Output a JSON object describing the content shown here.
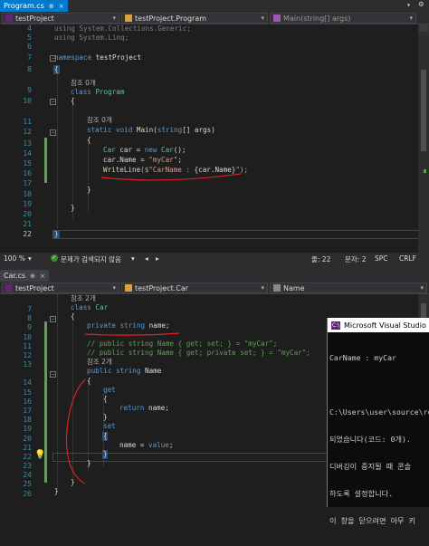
{
  "top": {
    "tab": {
      "label": "Program.cs",
      "pin": "⊕",
      "close": "×"
    },
    "nav": {
      "project": "testProject",
      "class": "testProject.Program",
      "member": "Main(string[] args)"
    },
    "lines": [
      {
        "n": "4"
      },
      {
        "n": "5"
      },
      {
        "n": "6"
      },
      {
        "n": "7"
      },
      {
        "n": "8"
      },
      {
        "n": "9"
      },
      {
        "n": "10"
      },
      {
        "n": "11"
      },
      {
        "n": "12"
      },
      {
        "n": "13"
      },
      {
        "n": "14"
      },
      {
        "n": "15"
      },
      {
        "n": "16"
      },
      {
        "n": "17"
      },
      {
        "n": "18"
      },
      {
        "n": "19"
      },
      {
        "n": "20"
      },
      {
        "n": "21"
      },
      {
        "n": "22"
      }
    ],
    "code": {
      "l4a": "using",
      "l4b": " System.Collections.Generic;",
      "l5a": "using",
      "l5b": " System.Linq;",
      "l7a": "namespace",
      "l7b": " testProject",
      "l8": "{",
      "l9ref": "참조 0개",
      "l9a": "class",
      "l9b": "Program",
      "l10": "{",
      "l11ref": "참조 0개",
      "l11a": "static",
      "l11b": "void",
      "l11c": "Main",
      "l11d": "(",
      "l11e": "string",
      "l11f": "[] args)",
      "l12": "{",
      "l13a": "Car",
      "l13b": " car = ",
      "l13c": "new",
      "l13d": " Car",
      "l13e": "();",
      "l14a": "car.Name = ",
      "l14b": "\"myCar\"",
      "l14c": ";",
      "l15a": "WriteLine",
      "l15b": "($\"",
      "l15c": "CarName : ",
      "l15d": "{car.Name}",
      "l15e": "\");",
      "l17": "}",
      "l19": "}",
      "l20": "}"
    }
  },
  "status": {
    "zoom": "100 %",
    "issues": "문제가 검색되지 않음",
    "line": "줄: 22",
    "char": "문자: 2",
    "ws": "SPC",
    "eol": "CRLF"
  },
  "bottom": {
    "tab": {
      "label": "Car.cs",
      "pin": "⊕",
      "close": "×"
    },
    "nav": {
      "project": "testProject",
      "class": "testProject.Car",
      "member": "Name"
    },
    "lines": [
      {
        "n": "7"
      },
      {
        "n": "8"
      },
      {
        "n": "9"
      },
      {
        "n": "10"
      },
      {
        "n": "11"
      },
      {
        "n": "12"
      },
      {
        "n": "13"
      },
      {
        "n": "14"
      },
      {
        "n": "15"
      },
      {
        "n": "16"
      },
      {
        "n": "17"
      },
      {
        "n": "18"
      },
      {
        "n": "19"
      },
      {
        "n": "20"
      },
      {
        "n": "21"
      },
      {
        "n": "22"
      },
      {
        "n": "23"
      },
      {
        "n": "24"
      },
      {
        "n": "25"
      },
      {
        "n": "26"
      }
    ],
    "code": {
      "ref7": "참조 2개",
      "l8a": "class",
      "l8b": " Car",
      "l9": "{",
      "l10a": "private",
      "l10b": " string",
      "l10c": " name;",
      "l12": "// public string Name { get; set; } = \"myCar\";",
      "l13": "// public string Name { get; private set; } = \"myCar\";",
      "ref13": "참조 2개",
      "l14a": "public",
      "l14b": " string",
      "l14c": " Name",
      "l15": "{",
      "l16": "get",
      "l17": "{",
      "l18a": "return",
      "l18b": " name;",
      "l19": "}",
      "l20": "set",
      "l21": "{",
      "l22a": "name = ",
      "l22b": "value",
      "l22c": ";",
      "l23": "}",
      "l24": "}",
      "l25": "}",
      "l26": "}"
    }
  },
  "console": {
    "title": "Microsoft Visual Studio 디",
    "icon": "C:\\",
    "lines": [
      "CarName : myCar",
      "",
      "C:\\Users\\user\\source\\re",
      "되었습니다(코드: 0개).",
      "디버깅이 중지될 때 콘솔",
      "하도록 설정합니다.",
      "이 창을 닫으려면 아무 키"
    ]
  }
}
